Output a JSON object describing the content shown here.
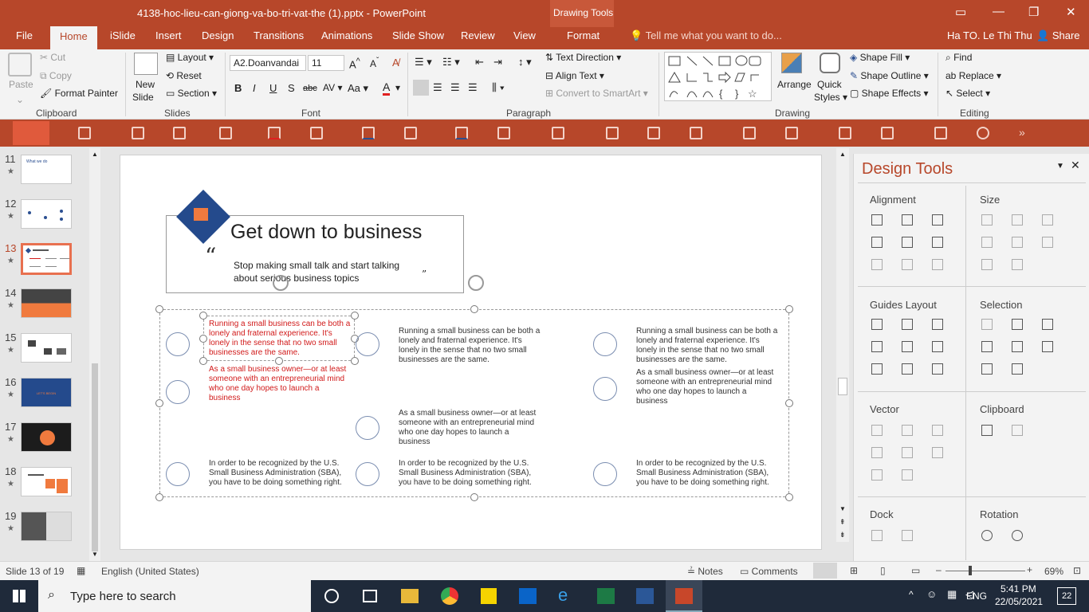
{
  "window": {
    "title": "4138-hoc-lieu-can-giong-va-bo-tri-vat-the (1).pptx - PowerPoint",
    "contextual_group": "Drawing Tools",
    "user": "Ha TO. Le Thi Thu",
    "share": "Share"
  },
  "tabs": [
    "File",
    "Home",
    "iSlide",
    "Insert",
    "Design",
    "Transitions",
    "Animations",
    "Slide Show",
    "Review",
    "View",
    "Format"
  ],
  "active_tab": "Home",
  "tell_me": "Tell me what you want to do...",
  "ribbon": {
    "clipboard": {
      "label": "Clipboard",
      "paste": "Paste",
      "cut": "Cut",
      "copy": "Copy",
      "format_painter": "Format Painter"
    },
    "slides": {
      "label": "Slides",
      "new_slide": "New",
      "new_slide2": "Slide",
      "layout": "Layout",
      "reset": "Reset",
      "section": "Section"
    },
    "font": {
      "label": "Font",
      "name": "A2.Doanvandai",
      "size": "11"
    },
    "paragraph": {
      "label": "Paragraph",
      "text_direction": "Text Direction",
      "align_text": "Align Text",
      "smartart": "Convert to SmartArt"
    },
    "drawing": {
      "label": "Drawing",
      "arrange": "Arrange",
      "quick_styles": "Quick",
      "quick_styles2": "Styles",
      "shape_fill": "Shape Fill",
      "shape_outline": "Shape Outline",
      "shape_effects": "Shape Effects"
    },
    "editing": {
      "label": "Editing",
      "find": "Find",
      "replace": "Replace",
      "select": "Select"
    }
  },
  "thumbnails": [
    {
      "num": "11",
      "text": "What we do"
    },
    {
      "num": "12",
      "text": ""
    },
    {
      "num": "13",
      "text": ""
    },
    {
      "num": "14",
      "text": ""
    },
    {
      "num": "15",
      "text": ""
    },
    {
      "num": "16",
      "text": "LET'S BEGIN"
    },
    {
      "num": "17",
      "text": ""
    },
    {
      "num": "18",
      "text": ""
    },
    {
      "num": "19",
      "text": ""
    }
  ],
  "slide": {
    "title": "Get down to business",
    "quote_open": "“",
    "quote": "Stop making small talk and start talking about serious business topics",
    "quote_close": "”",
    "text_running": "Running a small business can be both a lonely and fraternal experience. It's lonely in the sense that no two small businesses are the same.",
    "text_owner": "As a small business owner—or at least someone with an entrepreneurial mind who one day hopes to launch a business",
    "text_sba": "In order to be recognized by the U.S. Small Business Administration (SBA), you have to be doing something right."
  },
  "design_tools": {
    "title": "Design Tools",
    "sections": [
      "Alignment",
      "Size",
      "Guides Layout",
      "Selection",
      "Vector",
      "Clipboard",
      "Dock",
      "Rotation"
    ]
  },
  "status": {
    "slide": "Slide 13 of 19",
    "language": "English (United States)",
    "notes": "Notes",
    "comments": "Comments",
    "zoom": "69%"
  },
  "taskbar": {
    "search": "Type here to search",
    "time": "5:41 PM",
    "date": "22/05/2021",
    "lang": "ENG",
    "notifications": "22"
  }
}
